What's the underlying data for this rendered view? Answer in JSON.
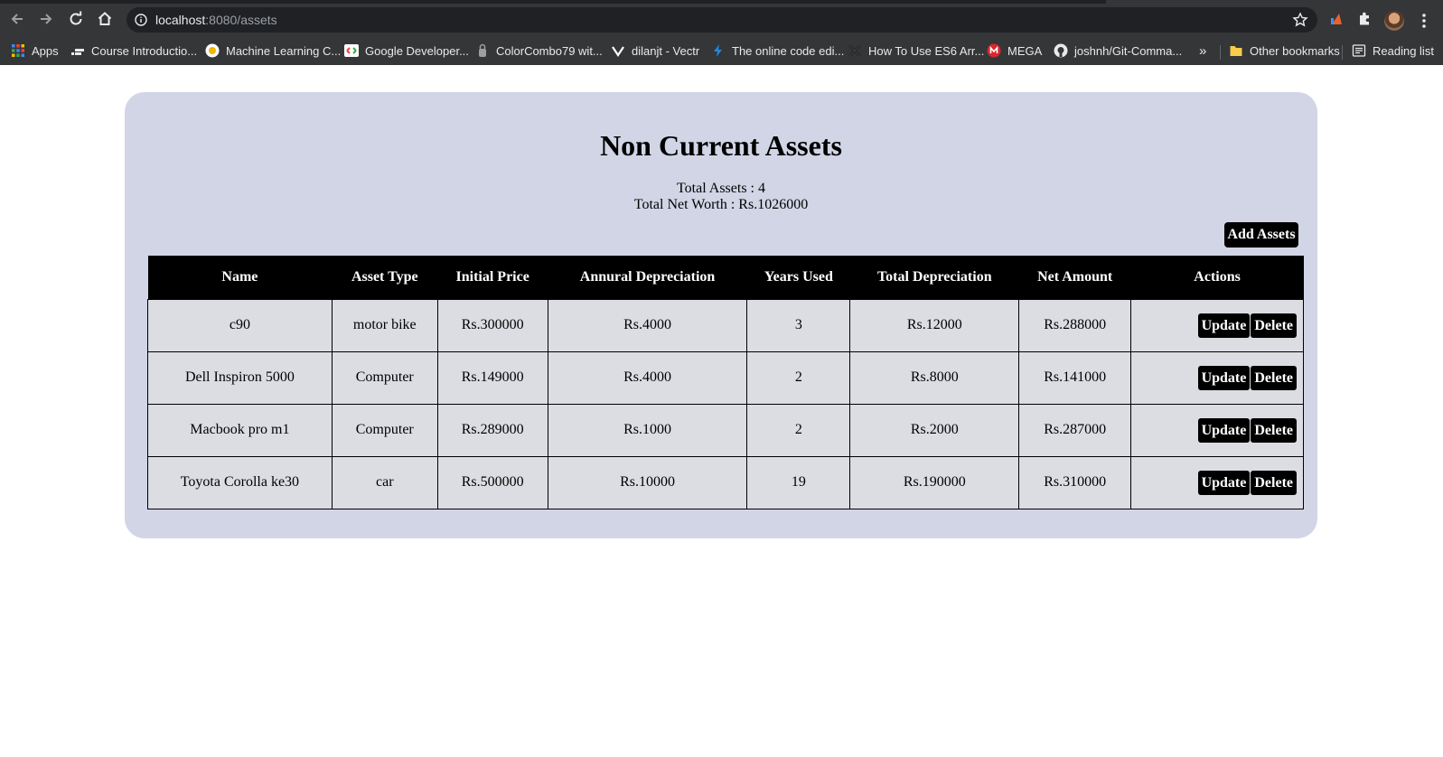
{
  "browser": {
    "url_host": "localhost",
    "url_path": ":8080/assets",
    "bookmarks": [
      {
        "label": "Apps",
        "icon": "apps-grid-icon"
      },
      {
        "label": "Course Introductio...",
        "icon": "course-icon"
      },
      {
        "label": "Machine Learning C...",
        "icon": "ml-icon"
      },
      {
        "label": "Google Developer...",
        "icon": "google-dev-icon"
      },
      {
        "label": "ColorCombo79 wit...",
        "icon": "colorcombo-icon"
      },
      {
        "label": "dilanjt - Vectr",
        "icon": "vectr-icon"
      },
      {
        "label": "The online code edi...",
        "icon": "code-editor-icon"
      },
      {
        "label": "How To Use ES6 Arr...",
        "icon": "es6-icon"
      },
      {
        "label": "MEGA",
        "icon": "mega-icon"
      },
      {
        "label": "joshnh/Git-Comma...",
        "icon": "github-icon"
      }
    ],
    "overflow_label": "»",
    "other_bookmarks": "Other bookmarks",
    "reading_list": "Reading list"
  },
  "page": {
    "title": "Non Current Assets",
    "total_assets": "Total Assets : 4",
    "total_net_worth": "Total Net Worth : Rs.1026000",
    "add_button": "Add Assets",
    "table": {
      "headers": [
        "Name",
        "Asset Type",
        "Initial Price",
        "Annural Depreciation",
        "Years Used",
        "Total Depreciation",
        "Net Amount",
        "Actions"
      ],
      "rows": [
        [
          "c90",
          "motor bike",
          "Rs.300000",
          "Rs.4000",
          "3",
          "Rs.12000",
          "Rs.288000"
        ],
        [
          "Dell Inspiron 5000",
          "Computer",
          "Rs.149000",
          "Rs.4000",
          "2",
          "Rs.8000",
          "Rs.141000"
        ],
        [
          "Macbook pro m1",
          "Computer",
          "Rs.289000",
          "Rs.1000",
          "2",
          "Rs.2000",
          "Rs.287000"
        ],
        [
          "Toyota Corolla ke30",
          "car",
          "Rs.500000",
          "Rs.10000",
          "19",
          "Rs.190000",
          "Rs.310000"
        ]
      ],
      "update_label": "Update",
      "delete_label": "Delete"
    }
  },
  "colors": {
    "card_background": "#d2d5e6",
    "row_background": "#dcdde3",
    "header_background": "#000000",
    "button_background": "#000000"
  }
}
